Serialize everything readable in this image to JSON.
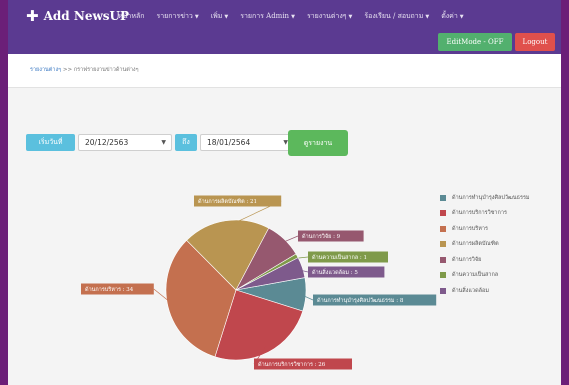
{
  "navbar": {
    "brand": "Add NewsUP",
    "menu": [
      {
        "label": "หน้าหลัก",
        "dropdown": false
      },
      {
        "label": "รายการข่าว",
        "dropdown": true
      },
      {
        "label": "เพิ่ม",
        "dropdown": true
      },
      {
        "label": "รายการ Admin",
        "dropdown": true
      },
      {
        "label": "รายงานต่างๆ",
        "dropdown": true
      },
      {
        "label": "ร้องเรียน / สอบถาม",
        "dropdown": true
      },
      {
        "label": "ตั้งค่า",
        "dropdown": true
      }
    ],
    "editmode_label": "EditMode - OFF",
    "logout_label": "Logout",
    "colors": {
      "bar": "#5b3a91",
      "editmode": "#52b06e",
      "logout": "#e0504c"
    }
  },
  "breadcrumb": {
    "link": "รายงานต่างๆ",
    "separator": ">>",
    "current": "กราฟรายงานข่าวด้านต่างๆ"
  },
  "filter": {
    "start_label": "เริ่มวันที่",
    "start_value": "20/12/2563",
    "to_label": "ถึง",
    "end_value": "18/01/2564",
    "report_button": "ดูรายงาน"
  },
  "chart_data": {
    "type": "pie",
    "slices": [
      {
        "name": "ด้านการทำนุบำรุงศิลปวัฒนธรรม",
        "value": 8,
        "color": "#5b8a94"
      },
      {
        "name": "ด้านการบริการวิชาการ",
        "value": 26,
        "color": "#c0474d"
      },
      {
        "name": "ด้านการบริหาร",
        "value": 34,
        "color": "#c4704f"
      },
      {
        "name": "ด้านการผลิตบัณฑิต",
        "value": 21,
        "color": "#b99551"
      },
      {
        "name": "ด้านการวิจัย",
        "value": 9,
        "color": "#96586f"
      },
      {
        "name": "ด้านความเป็นสากล",
        "value": 1,
        "color": "#7f9a4a"
      },
      {
        "name": "ด้านสิ่งแวดล้อม",
        "value": 5,
        "color": "#7e5a8c"
      }
    ],
    "legend_position": "right"
  }
}
